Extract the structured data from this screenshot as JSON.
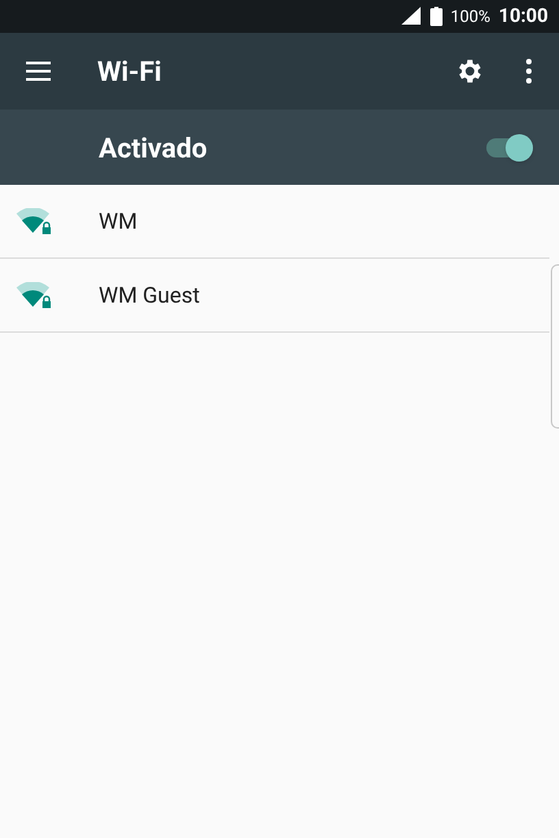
{
  "status_bar": {
    "battery": "100%",
    "time": "10:00"
  },
  "toolbar": {
    "title": "Wi-Fi"
  },
  "master_switch": {
    "label": "Activado",
    "on": true
  },
  "networks": [
    {
      "name": "WM",
      "secured": true
    },
    {
      "name": "WM Guest",
      "secured": true
    }
  ]
}
